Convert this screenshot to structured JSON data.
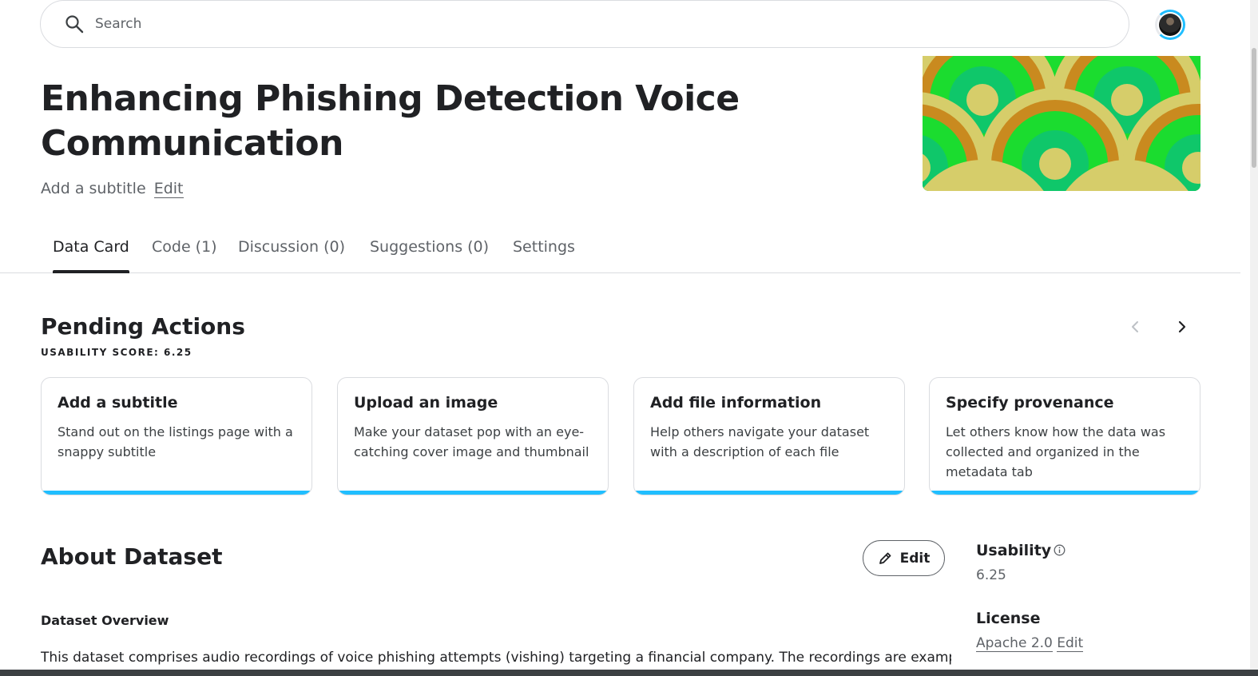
{
  "search": {
    "placeholder": "Search"
  },
  "dataset": {
    "title": "Enhancing Phishing Detection Voice Communication",
    "subtitle_prompt": "Add a subtitle",
    "subtitle_edit": "Edit"
  },
  "tabs": [
    {
      "label": "Data Card",
      "active": true
    },
    {
      "label": "Code (1)"
    },
    {
      "label": "Discussion (0)"
    },
    {
      "label": "Suggestions (0)"
    },
    {
      "label": "Settings"
    }
  ],
  "pending_actions": {
    "title": "Pending Actions",
    "usability_score": "USABILITY SCORE: 6.25",
    "cards": [
      {
        "title": "Add a subtitle",
        "description": "Stand out on the listings page with a snappy subtitle"
      },
      {
        "title": "Upload an image",
        "description": "Make your dataset pop with an eye-catching cover image and thumbnail"
      },
      {
        "title": "Add file information",
        "description": "Help others navigate your dataset with a description of each file"
      },
      {
        "title": "Specify provenance",
        "description": "Let others know how the data was collected and organized in the metadata tab"
      }
    ]
  },
  "about": {
    "title": "About Dataset",
    "edit_label": "Edit",
    "overview_heading": "Dataset Overview",
    "overview_text": "This dataset comprises audio recordings of voice phishing attempts (vishing) targeting a financial company. The recordings are examples"
  },
  "sidebar": {
    "usability_heading": "Usability",
    "usability_value": "6.25",
    "license_heading": "License",
    "license_value": "Apache 2.0",
    "license_edit": "Edit"
  },
  "colors": {
    "accent": "#20beff",
    "cover_green": "#1bdc2f",
    "cover_teal": "#0fc76a",
    "cover_gold": "#d6cd6a",
    "cover_orange": "#c98a1f"
  }
}
